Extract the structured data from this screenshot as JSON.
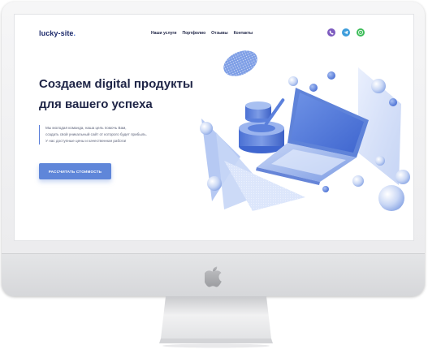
{
  "site": {
    "logo": {
      "text": "lucky-site",
      "dot": "."
    },
    "nav": [
      {
        "label": "Наши услуги"
      },
      {
        "label": "Портфолио"
      },
      {
        "label": "Отзывы"
      },
      {
        "label": "Контакты"
      }
    ],
    "socials": [
      {
        "name": "viber-icon",
        "color": "#7d5bbf"
      },
      {
        "name": "telegram-icon",
        "color": "#3d9ddb"
      },
      {
        "name": "whatsapp-icon",
        "color": "#3ebd5a"
      }
    ],
    "hero": {
      "title_line1": "Создаем digital продукты",
      "title_line2": "для вашего успеха",
      "description": [
        "Мы молодая команда, наша цель помочь Вам,",
        "создать свой уникальный сайт от которого будет прибыль.",
        "У нас доступные цены и качественная работа!"
      ],
      "cta_label": "РАССЧИТАТЬ СТОИМОСТЬ"
    }
  },
  "colors": {
    "accent": "#5f86d9",
    "text_dark": "#1e2446",
    "logo": "#1d2a6b"
  }
}
